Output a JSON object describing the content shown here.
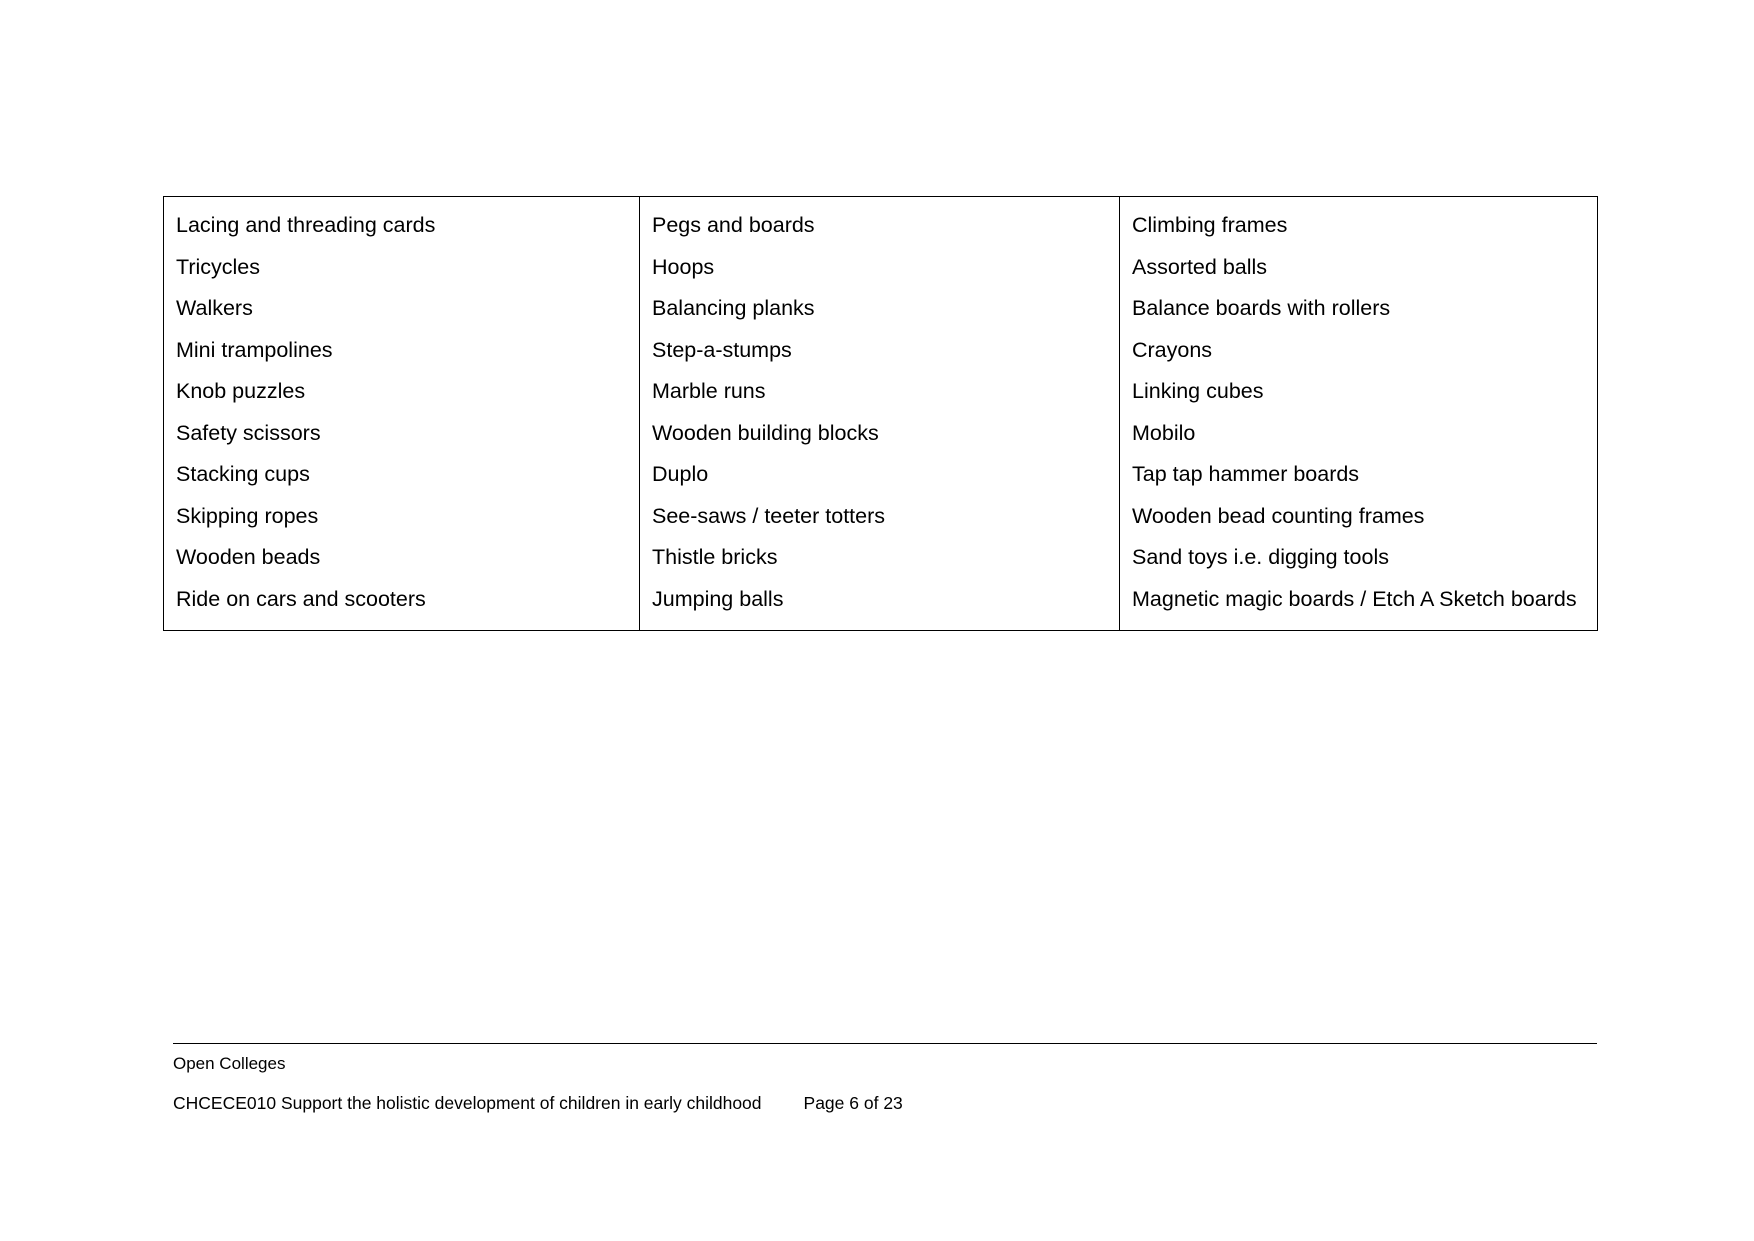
{
  "document": {
    "type": "resource-list-table",
    "border_color": "#000000",
    "text_color": "#000000",
    "background": "#ffffff"
  },
  "table": {
    "columns": [
      {
        "name": "column-1",
        "items": [
          "Lacing and threading cards",
          "Tricycles",
          "Walkers",
          "Mini trampolines",
          "Knob puzzles",
          "Safety scissors",
          "Stacking cups",
          "Skipping ropes",
          "Wooden beads",
          "Ride on cars and scooters"
        ]
      },
      {
        "name": "column-2",
        "items": [
          "Pegs and boards",
          "Hoops",
          "Balancing planks",
          "Step-a-stumps",
          "Marble runs",
          "Wooden building blocks",
          "Duplo",
          "See-saws / teeter totters",
          "Thistle bricks",
          "Jumping balls"
        ]
      },
      {
        "name": "column-3",
        "items": [
          "Climbing frames",
          "Assorted balls",
          "Balance boards with rollers",
          "Crayons",
          "Linking cubes",
          "Mobilo",
          "Tap tap hammer boards",
          "Wooden bead counting frames",
          "Sand toys i.e. digging tools",
          "Magnetic magic boards / Etch A Sketch boards"
        ]
      }
    ]
  },
  "footer": {
    "organisation": "Open Colleges",
    "unit": "CHCECE010 Support the holistic development of children in early childhood",
    "page": "Page 6 of 23"
  }
}
